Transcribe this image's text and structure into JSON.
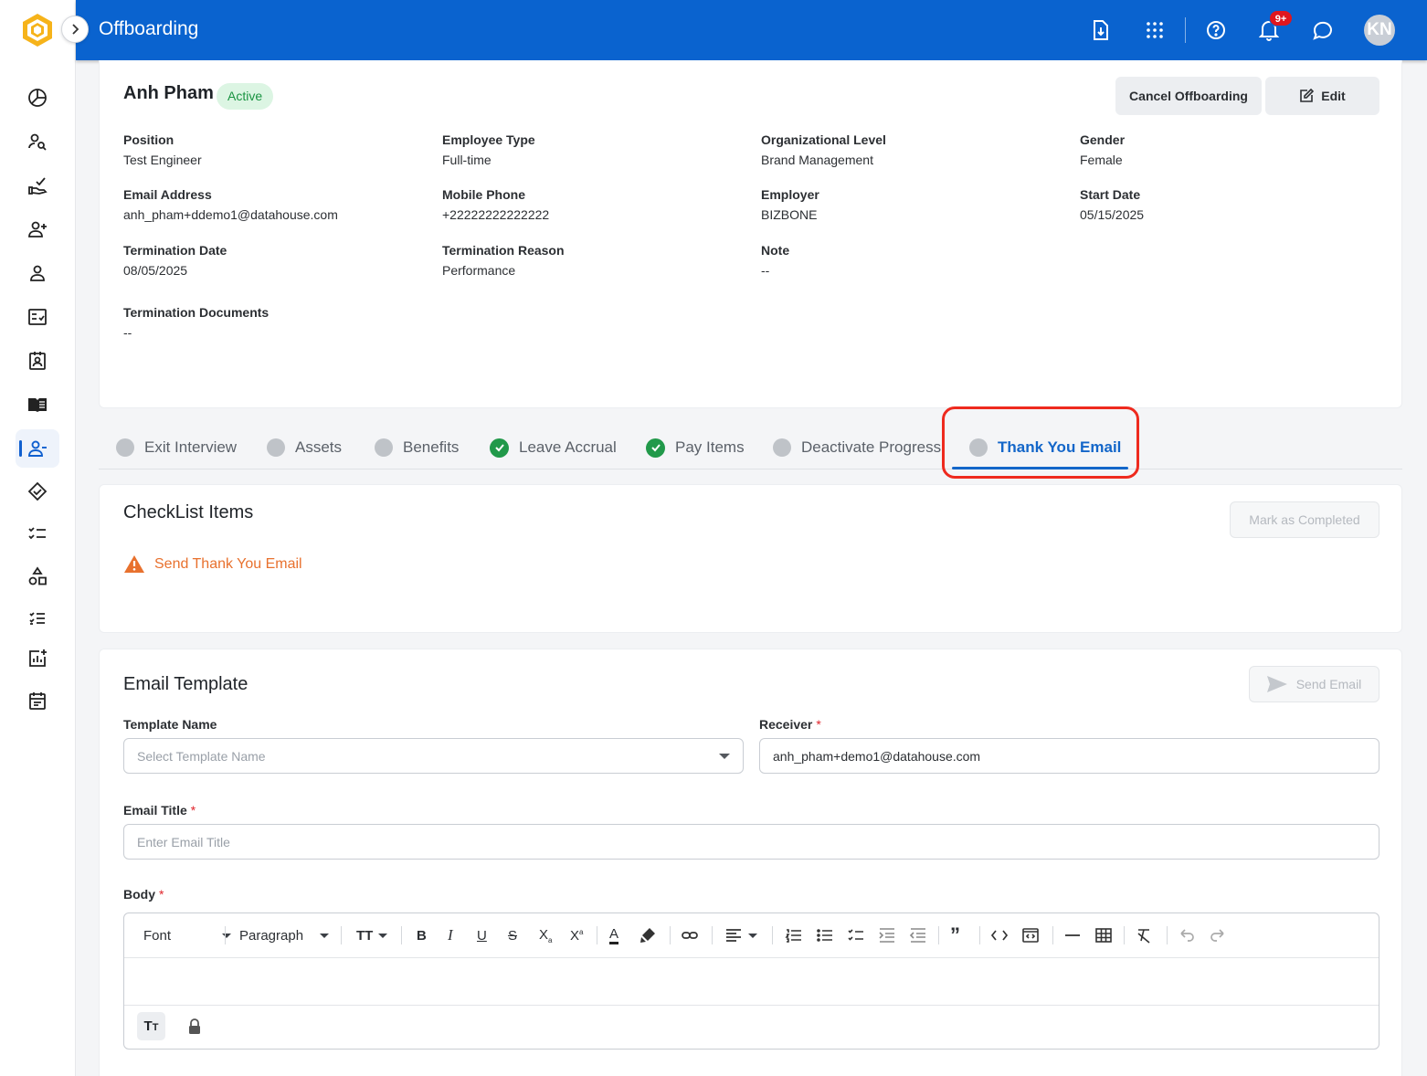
{
  "header": {
    "title": "Offboarding",
    "notification_count": "9+",
    "avatar_initials": "KN",
    "brand_color": "#0a63cf"
  },
  "sidebar": {
    "items": [
      {
        "icon": "dashboard-icon"
      },
      {
        "icon": "user-search-icon"
      },
      {
        "icon": "hand-check-icon"
      },
      {
        "icon": "user-add-icon"
      },
      {
        "icon": "user-icon"
      },
      {
        "icon": "checklist-icon"
      },
      {
        "icon": "id-badge-icon"
      },
      {
        "icon": "book-icon"
      },
      {
        "icon": "user-remove-icon",
        "active": true
      },
      {
        "icon": "handshake-icon"
      },
      {
        "icon": "task-list-icon"
      },
      {
        "icon": "shapes-icon"
      },
      {
        "icon": "ordered-list-icon"
      },
      {
        "icon": "report-add-icon"
      },
      {
        "icon": "calendar-icon"
      }
    ]
  },
  "employee": {
    "name": "Anh Pham",
    "status": "Active",
    "cancel_label": "Cancel Offboarding",
    "edit_label": "Edit",
    "fields": {
      "position": {
        "label": "Position",
        "value": "Test Engineer"
      },
      "employee_type": {
        "label": "Employee Type",
        "value": "Full-time"
      },
      "org_level": {
        "label": "Organizational Level",
        "value": "Brand Management"
      },
      "gender": {
        "label": "Gender",
        "value": "Female"
      },
      "email": {
        "label": "Email Address",
        "value": "anh_pham+ddemo1@datahouse.com"
      },
      "mobile": {
        "label": "Mobile Phone",
        "value": "+22222222222222"
      },
      "employer": {
        "label": "Employer",
        "value": "BIZBONE"
      },
      "start_date": {
        "label": "Start Date",
        "value": "05/15/2025"
      },
      "termination_date": {
        "label": "Termination Date",
        "value": "08/05/2025"
      },
      "termination_reason": {
        "label": "Termination Reason",
        "value": "Performance"
      },
      "note": {
        "label": "Note",
        "value": "--"
      },
      "termination_docs": {
        "label": "Termination Documents",
        "value": "--"
      }
    }
  },
  "tabs": [
    {
      "label": "Exit Interview",
      "state": "pending"
    },
    {
      "label": "Assets",
      "state": "pending"
    },
    {
      "label": "Benefits",
      "state": "pending"
    },
    {
      "label": "Leave Accrual",
      "state": "done"
    },
    {
      "label": "Pay Items",
      "state": "done"
    },
    {
      "label": "Deactivate Progress",
      "state": "pending"
    },
    {
      "label": "Thank You Email",
      "state": "pending",
      "active": true
    }
  ],
  "checklist": {
    "title": "CheckList Items",
    "mark_completed_label": "Mark as Completed",
    "items": [
      {
        "label": "Send Thank You Email",
        "status": "warning"
      }
    ]
  },
  "email_template": {
    "title": "Email Template",
    "send_label": "Send Email",
    "template_name": {
      "label": "Template Name",
      "placeholder": "Select Template Name"
    },
    "receiver": {
      "label": "Receiver",
      "required_mark": "*",
      "value": "anh_pham+demo1@datahouse.com"
    },
    "email_title": {
      "label": "Email Title",
      "required_mark": "*",
      "placeholder": "Enter Email Title"
    },
    "body": {
      "label": "Body",
      "required_mark": "*"
    },
    "toolbar": {
      "font_label": "Font",
      "paragraph_label": "Paragraph"
    }
  }
}
